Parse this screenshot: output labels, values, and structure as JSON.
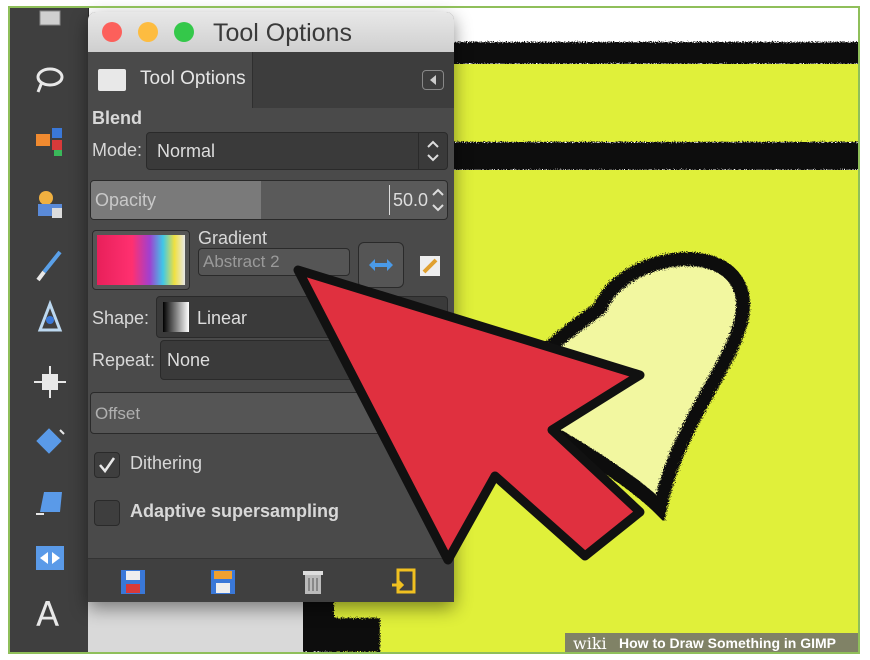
{
  "window": {
    "title": "Tool Options",
    "tab_label": "Tool Options"
  },
  "blend": {
    "section_label": "Blend",
    "mode_label": "Mode:",
    "mode_value": "Normal",
    "opacity_label": "Opacity",
    "opacity_value": "50.0",
    "opacity_fraction": 0.5,
    "gradient_label": "Gradient",
    "gradient_value": "Abstract 2",
    "shape_label": "Shape:",
    "shape_value": "Linear",
    "repeat_label": "Repeat:",
    "repeat_value": "None",
    "offset_label": "Offset",
    "dithering_label": "Dithering",
    "dithering_checked": true,
    "adaptive_label": "Adaptive supersampling",
    "adaptive_checked": false
  },
  "footer_icons": [
    "save-icon",
    "restore-icon",
    "delete-icon",
    "reset-icon"
  ],
  "toolbox_icons": [
    "free-select-icon",
    "fuzzy-select-icon",
    "clone-icon",
    "paintbrush-icon",
    "ink-icon",
    "move-icon",
    "rotate-icon",
    "perspective-icon",
    "flip-icon",
    "text-icon"
  ],
  "caption": {
    "brand": "wiki",
    "text": "How to Draw Something in GIMP"
  },
  "colors": {
    "panel_bg": "#4a4a4a",
    "canvas_yellow": "#e0f03a",
    "arrow_red": "#e0303f",
    "close_red": "#fc605b",
    "minimize_yellow": "#fdbc40",
    "zoom_green": "#34c84a"
  }
}
